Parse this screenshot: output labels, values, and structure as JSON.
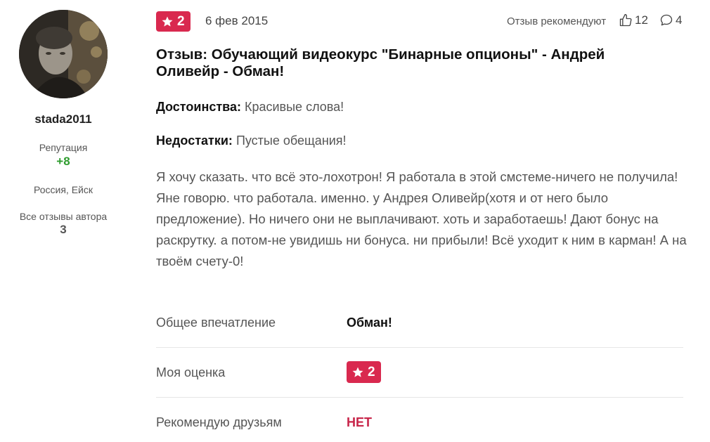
{
  "author": {
    "username": "stada2011",
    "reputation_label": "Репутация",
    "reputation_value": "+8",
    "location": "Россия, Ейск",
    "all_reviews_label": "Все отзывы автора",
    "all_reviews_count": "3"
  },
  "meta": {
    "rating": "2",
    "date": "6 фев 2015",
    "recommend_label": "Отзыв рекомендуют",
    "likes": "12",
    "comments": "4"
  },
  "review": {
    "title": "Отзыв: Обучающий видеокурс \"Бинарные опционы\" - Андрей Оливейр - Обман!",
    "pros_label": "Достоинства:",
    "pros": "Красивые слова!",
    "cons_label": "Недостатки:",
    "cons": "Пустые обещания!",
    "text": "Я хочу сказать. что всё это-лохотрон! Я работала в этой смстеме-ничего не получила! Яне говорю. что работала. именно. у Андрея Оливейр(хотя и от него было предложение). Но ничего они не выплачивают. хоть и заработаешь! Дают бонус на раскрутку. а потом-не увидишь ни бонуса. ни прибыли! Всё уходит к ним в карман! А на твоём счету-0!"
  },
  "summary": {
    "impression_label": "Общее впечатление",
    "impression_value": "Обман!",
    "my_rating_label": "Моя оценка",
    "my_rating_value": "2",
    "recommend_label": "Рекомендую друзьям",
    "recommend_value": "НЕТ"
  },
  "colors": {
    "accent": "#d9294f",
    "reputation": "#2e9c2e",
    "negative": "#c8264a"
  },
  "icons": [
    "star-icon",
    "thumbs-up-icon",
    "comment-icon"
  ]
}
